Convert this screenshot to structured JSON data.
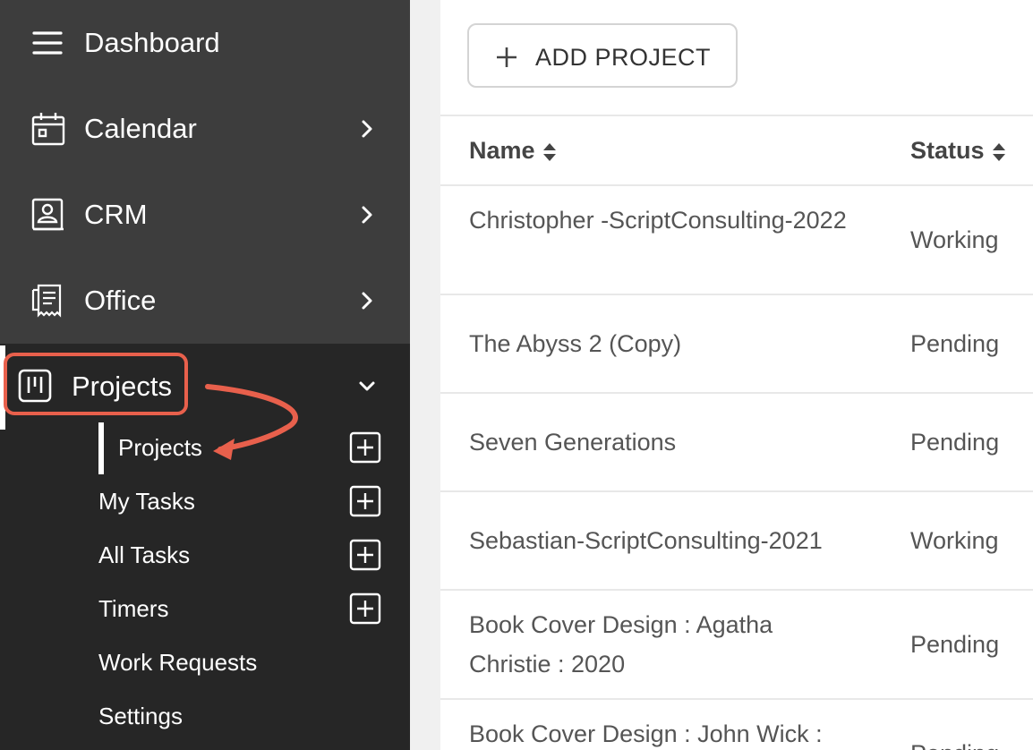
{
  "sidebar": {
    "items": [
      {
        "label": "Dashboard",
        "icon": "menu-icon"
      },
      {
        "label": "Calendar",
        "icon": "calendar-icon"
      },
      {
        "label": "CRM",
        "icon": "contact-book-icon"
      },
      {
        "label": "Office",
        "icon": "receipt-icon"
      },
      {
        "label": "Projects",
        "icon": "kanban-board-icon"
      }
    ],
    "sub_items": [
      {
        "label": "Projects"
      },
      {
        "label": "My Tasks"
      },
      {
        "label": "All Tasks"
      },
      {
        "label": "Timers"
      },
      {
        "label": "Work Requests"
      },
      {
        "label": "Settings"
      }
    ]
  },
  "main": {
    "add_button_label": "ADD PROJECT",
    "columns": [
      "Name",
      "Status"
    ],
    "rows": [
      {
        "name": "Christopher -ScriptConsulting-2022",
        "status": "Working"
      },
      {
        "name": "The Abyss 2 (Copy)",
        "status": "Pending"
      },
      {
        "name": "Seven Generations",
        "status": "Pending"
      },
      {
        "name": "Sebastian-ScriptConsulting-2021",
        "status": "Working"
      },
      {
        "name": "Book Cover Design : Agatha Christie : 2020",
        "status": "Pending"
      },
      {
        "name": "Book Cover Design : John Wick :",
        "status": "Pending"
      }
    ]
  },
  "colors": {
    "sidebar_top": "#3d3d3d",
    "sidebar_bottom": "#262626",
    "annotation": "#e8604c"
  }
}
